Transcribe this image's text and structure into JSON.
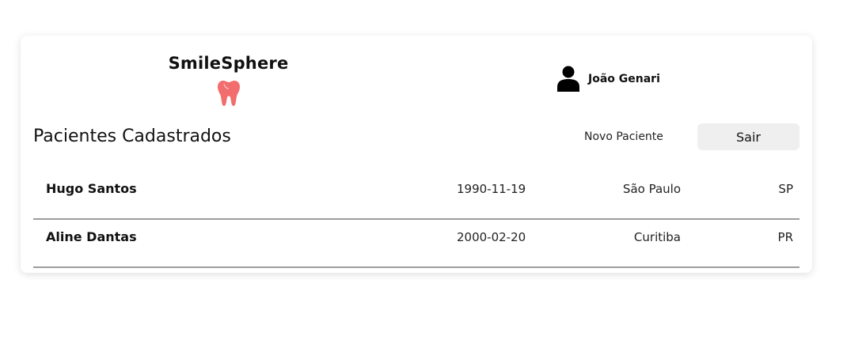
{
  "app": {
    "brand_name": "SmileSphere",
    "brand_icon": "tooth-icon",
    "brand_color": "#f26d6d"
  },
  "user": {
    "icon": "user-icon",
    "name": "João Genari"
  },
  "page": {
    "title": "Pacientes Cadastrados",
    "new_patient_label": "Novo Paciente",
    "exit_label": "Sair"
  },
  "patients": [
    {
      "name": "Hugo Santos",
      "birth_date": "1990-11-19",
      "city": "São Paulo",
      "state": "SP"
    },
    {
      "name": "Aline Dantas",
      "birth_date": "2000-02-20",
      "city": "Curitiba",
      "state": "PR"
    }
  ]
}
